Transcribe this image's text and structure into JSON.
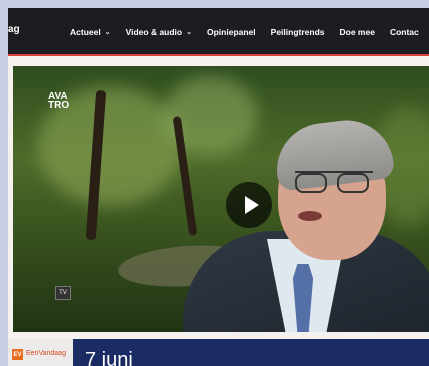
{
  "header": {
    "brand": "ag",
    "nav": [
      {
        "label": "Actueel",
        "has_dropdown": true
      },
      {
        "label": "Video & audio",
        "has_dropdown": true
      },
      {
        "label": "Opiniepanel",
        "has_dropdown": false
      },
      {
        "label": "Peilingtrends",
        "has_dropdown": false
      },
      {
        "label": "Doe mee",
        "has_dropdown": false
      },
      {
        "label": "Contac",
        "has_dropdown": false
      }
    ]
  },
  "video": {
    "overlay_logo": "AVA\nTRO",
    "tv_label": "TV"
  },
  "footer": {
    "logo_mark": "EV",
    "logo_text": "EenVandaag",
    "date": "7 juni"
  },
  "colors": {
    "accent_red": "#d9423a",
    "nav_bg": "#1d1c20",
    "date_bar": "#1b2b64"
  }
}
